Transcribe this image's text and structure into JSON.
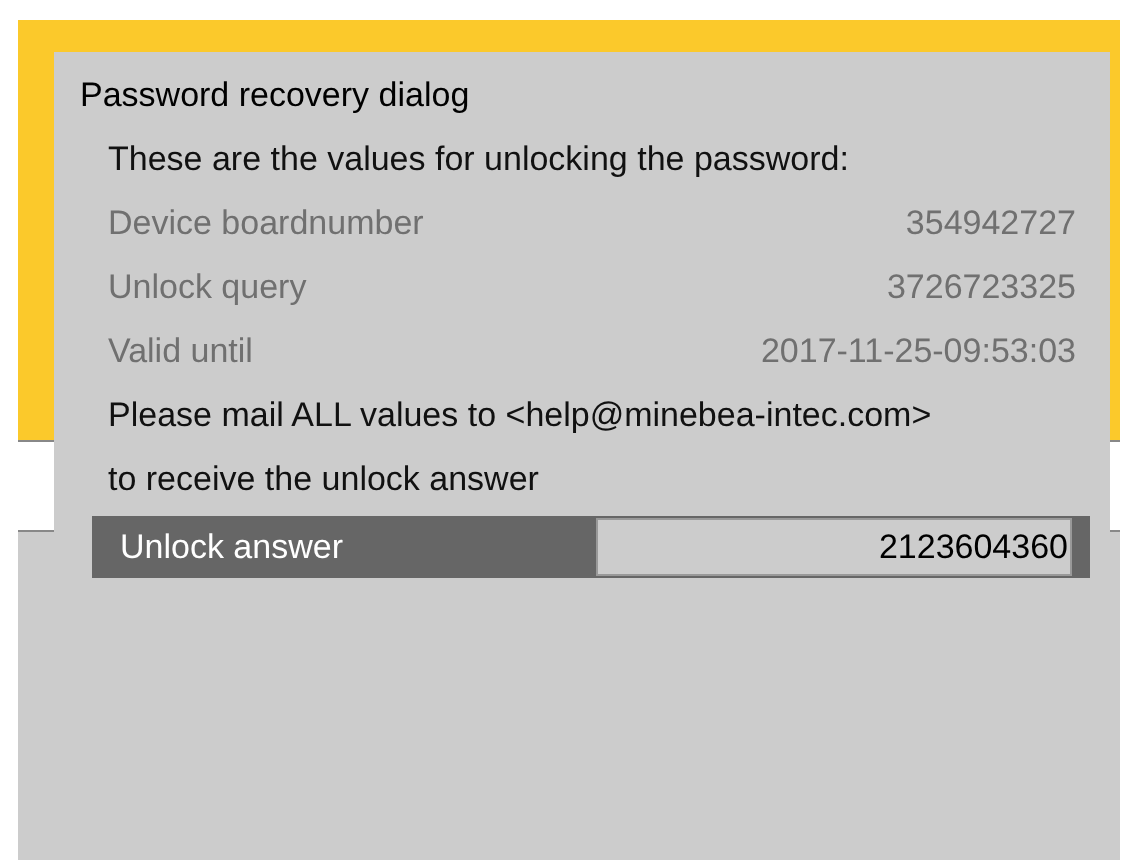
{
  "dialog": {
    "title": "Password recovery dialog",
    "intro": "These are the values for unlocking the password:",
    "fields": [
      {
        "label": "Device boardnumber",
        "value": "354942727"
      },
      {
        "label": "Unlock query",
        "value": "3726723325"
      },
      {
        "label": "Valid until",
        "value": "2017-11-25-09:53:03"
      }
    ],
    "notes": [
      "Please mail ALL values to <help@minebea-intec.com>",
      "to receive the unlock answer"
    ],
    "answer": {
      "label": "Unlock answer",
      "value": "2123604360"
    }
  }
}
